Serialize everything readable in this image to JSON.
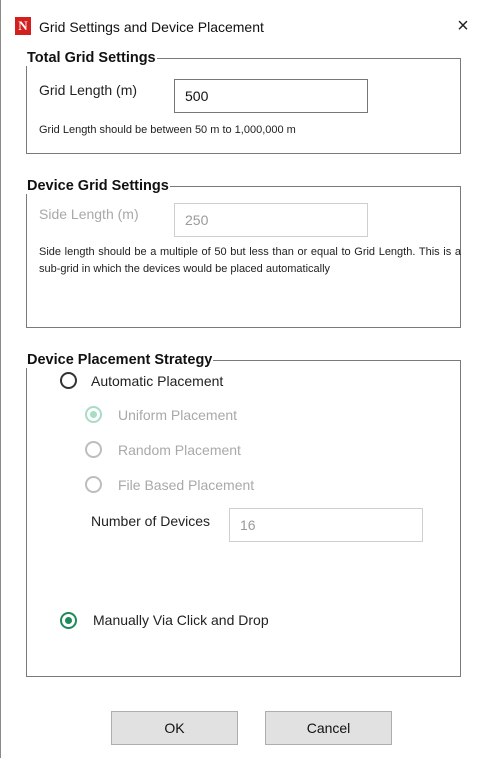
{
  "window": {
    "title": "Grid Settings and Device Placement",
    "close": "×",
    "app_icon": "N"
  },
  "total_grid": {
    "legend": "Total Grid Settings",
    "label": "Grid Length (m)",
    "value": "500",
    "hint": "Grid Length should be between 50 m to 1,000,000 m"
  },
  "device_grid": {
    "legend": "Device Grid Settings",
    "label": "Side Length (m)",
    "value": "250",
    "hint": "Side length should be a multiple of 50 but less than or equal to Grid Length. This is a sub-grid in which the devices would be placed automatically"
  },
  "strategy": {
    "legend": "Device Placement Strategy",
    "automatic": "Automatic Placement",
    "uniform": "Uniform Placement",
    "random": "Random Placement",
    "file_based": "File Based Placement",
    "num_devices_label": "Number of Devices",
    "num_devices_value": "16",
    "manual": "Manually Via Click and Drop"
  },
  "buttons": {
    "ok": "OK",
    "cancel": "Cancel"
  }
}
